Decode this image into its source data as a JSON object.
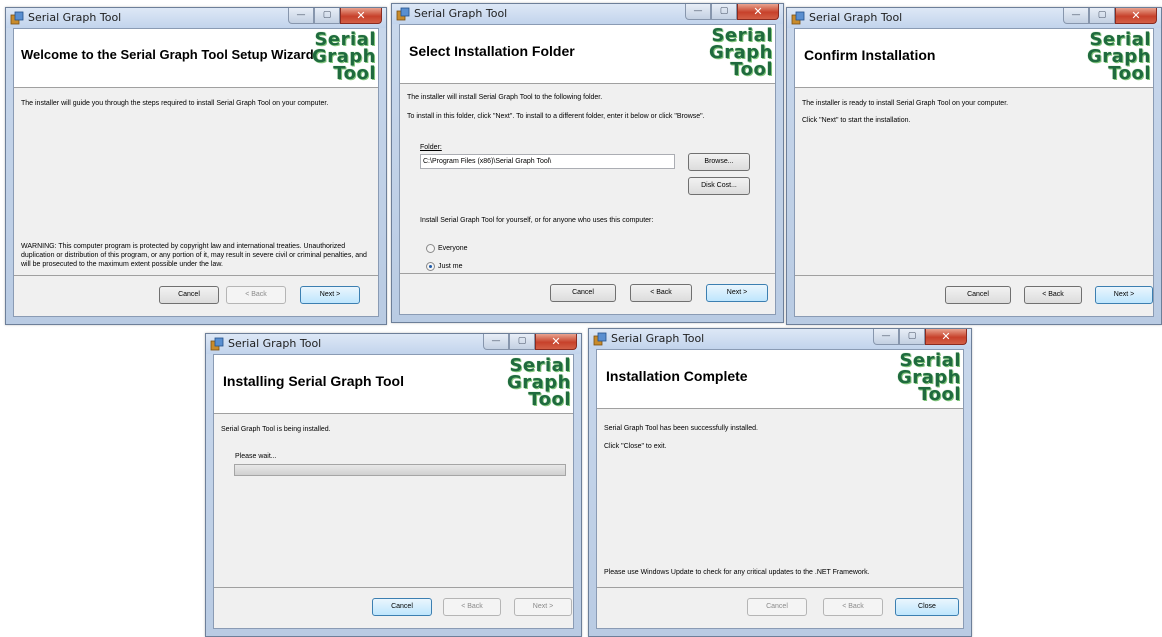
{
  "app_title": "Serial Graph Tool",
  "window_controls": {
    "minimize": "—",
    "maximize": "▢",
    "close": "✕"
  },
  "logo": {
    "line1": "Serial",
    "line2": "Graph",
    "line3": "Tool"
  },
  "colors": {
    "logo_green": "#1f6b3e",
    "progress_green": "#06b025",
    "accent_blue": "#3c7fb1"
  },
  "buttons": {
    "cancel": "Cancel",
    "back": "< Back",
    "next": "Next >",
    "close": "Close",
    "browse": "Browse...",
    "disk_cost": "Disk Cost..."
  },
  "welcome": {
    "heading": "Welcome to the Serial Graph Tool Setup Wizard",
    "intro": "The installer will guide you through the steps required to install Serial Graph Tool on your computer.",
    "warning": "WARNING: This computer program is protected by copyright law and international treaties. Unauthorized duplication or distribution of this program, or any portion of it, may result in severe civil or criminal penalties, and will be prosecuted to the maximum extent possible under the law."
  },
  "folder": {
    "heading": "Select Installation Folder",
    "line1": "The installer will install Serial Graph Tool to the following folder.",
    "line2": "To install in this folder, click \"Next\". To install to a different folder, enter it below or click \"Browse\".",
    "folder_label": "Folder:",
    "folder_value": "C:\\Program Files (x86)\\Serial Graph Tool\\",
    "install_for": "Install Serial Graph Tool for yourself, or for anyone who uses this computer:",
    "option_everyone": "Everyone",
    "option_just_me": "Just me",
    "selected_option": "Just me"
  },
  "confirm": {
    "heading": "Confirm Installation",
    "line1": "The installer is ready to install Serial Graph Tool on your computer.",
    "line2": "Click \"Next\" to start the installation."
  },
  "installing": {
    "heading": "Installing Serial Graph Tool",
    "line1": "Serial Graph Tool is being installed.",
    "please_wait": "Please wait...",
    "progress": 0
  },
  "complete": {
    "heading": "Installation Complete",
    "line1": "Serial Graph Tool has been successfully installed.",
    "line2": "Click \"Close\" to exit.",
    "update_note": "Please use Windows Update to check for any critical updates to the .NET Framework."
  }
}
